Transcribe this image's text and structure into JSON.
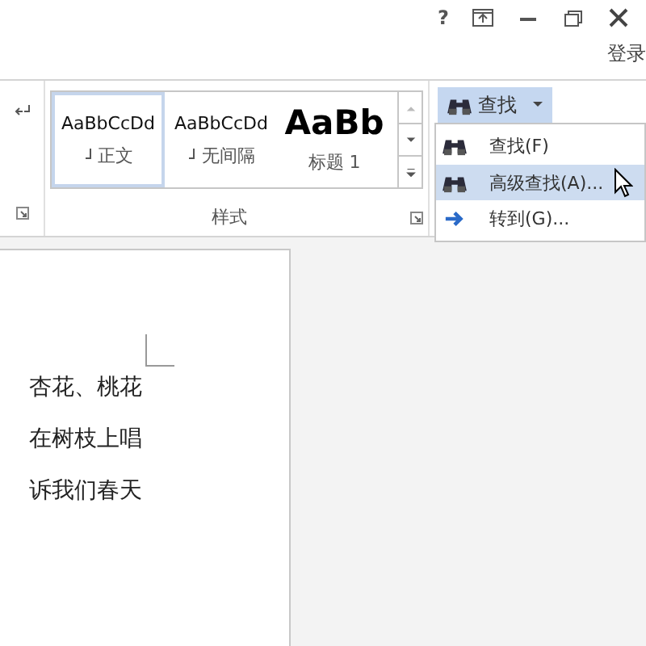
{
  "window": {
    "help": "?",
    "account": "登录"
  },
  "ribbon": {
    "styles": {
      "items": [
        {
          "preview": "AaBbCcDd",
          "label": "正文",
          "kind": "body",
          "selected": true
        },
        {
          "preview": "AaBbCcDd",
          "label": "无间隔",
          "kind": "body",
          "selected": false
        },
        {
          "preview": "AaBb",
          "label": "标题 1",
          "kind": "heading",
          "selected": false
        }
      ],
      "group_label": "样式"
    },
    "find_button": {
      "label": "查找",
      "expanded": true
    }
  },
  "find_menu": {
    "items": [
      {
        "label": "查找(F)",
        "kind": "search",
        "highlighted": false
      },
      {
        "label": "高级查找(A)...",
        "kind": "search",
        "highlighted": true
      },
      {
        "label": "转到(G)...",
        "kind": "navigate",
        "highlighted": false
      }
    ]
  },
  "document": {
    "lines": [
      "杏花、桃花",
      "在树枝上唱",
      "诉我们春天"
    ]
  }
}
